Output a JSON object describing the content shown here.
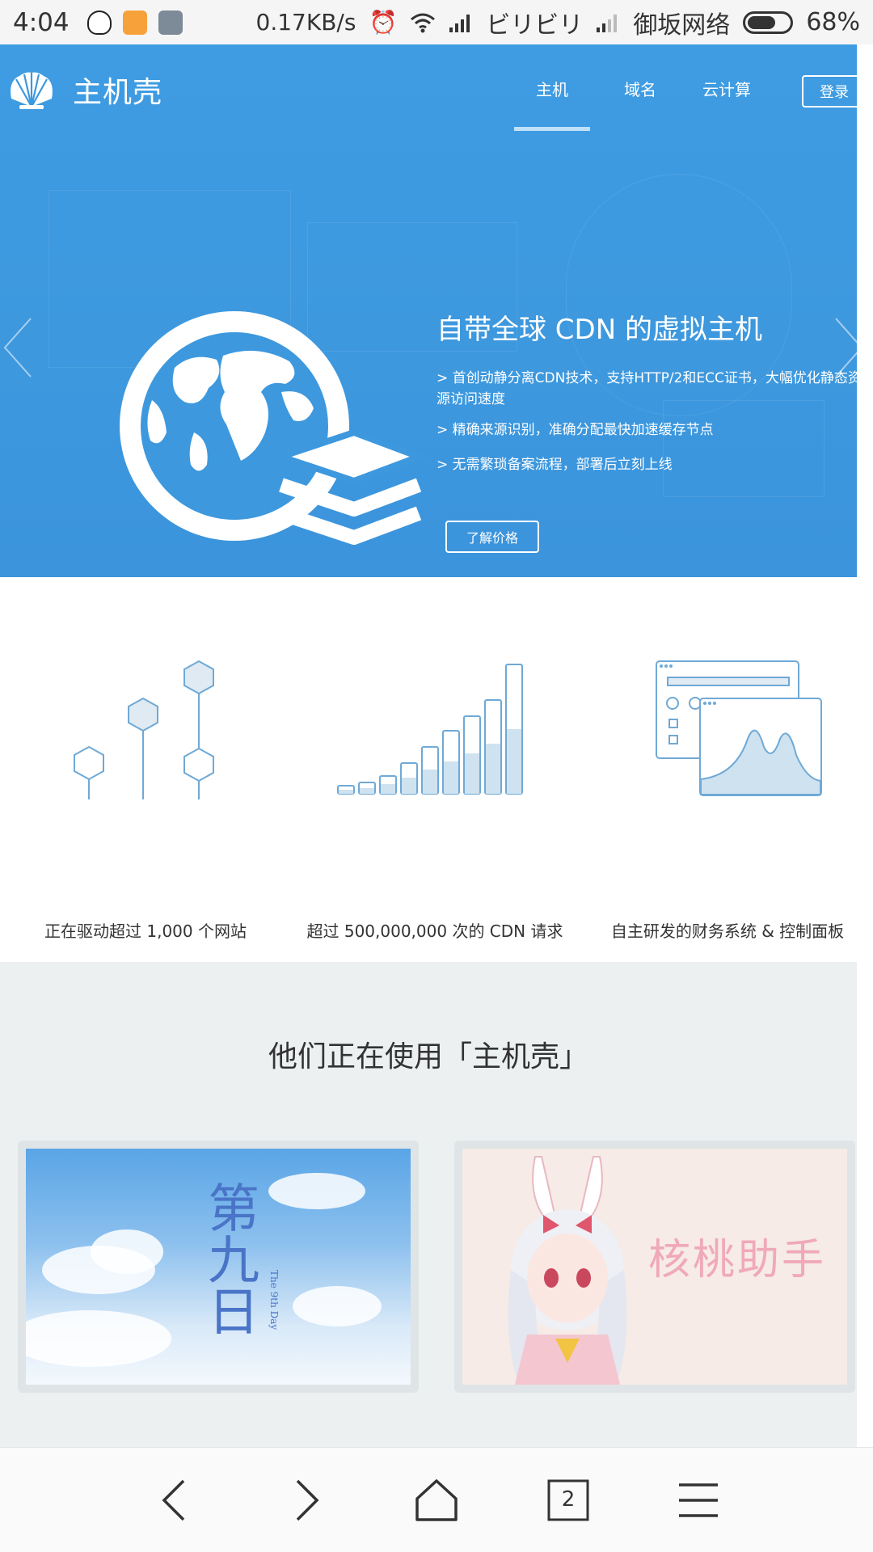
{
  "status_bar": {
    "time": "4:04",
    "speed": "0.17KB/s",
    "carrier1": "ビリビリ",
    "carrier2": "御坂网络",
    "battery": "68%",
    "battery_level": 0.68
  },
  "navbar": {
    "logo_text": "主机壳",
    "items": [
      {
        "label": "主机",
        "active": true
      },
      {
        "label": "域名",
        "active": false
      },
      {
        "label": "云计算",
        "active": false
      }
    ],
    "login_label": "登录"
  },
  "hero": {
    "title": "自带全球 CDN 的虚拟主机",
    "bullets": [
      "> 首创动静分离CDN技术，支持HTTP/2和ECC证书，大幅优化静态资源访问速度",
      "> 精确来源识别，准确分配最快加速缓存节点",
      "> 无需繁琐备案流程，部署后立刻上线"
    ],
    "cta_label": "了解价格"
  },
  "features": [
    {
      "label": "正在驱动超过 1,000 个网站",
      "icon": "hexagon-nodes-icon"
    },
    {
      "label": "超过 500,000,000 次的 CDN 请求",
      "icon": "bar-growth-icon"
    },
    {
      "label": "自主研发的财务系统 & 控制面板",
      "icon": "dashboard-windows-icon"
    }
  ],
  "customers": {
    "title": "他们正在使用「主机壳」",
    "cards": [
      {
        "caption": "第九日",
        "subcaption": "The 9th Day"
      },
      {
        "caption": "核桃助手"
      }
    ]
  },
  "browser_bar": {
    "tab_count": "2",
    "icons": [
      "back-icon",
      "forward-icon",
      "home-icon",
      "tabs-icon",
      "menu-icon"
    ]
  },
  "colors": {
    "hero_blue": "#3d98de",
    "accent_light": "#bfe0f7",
    "icon_blue": "#6fa9d6",
    "section_gray": "#ecf0f1"
  }
}
